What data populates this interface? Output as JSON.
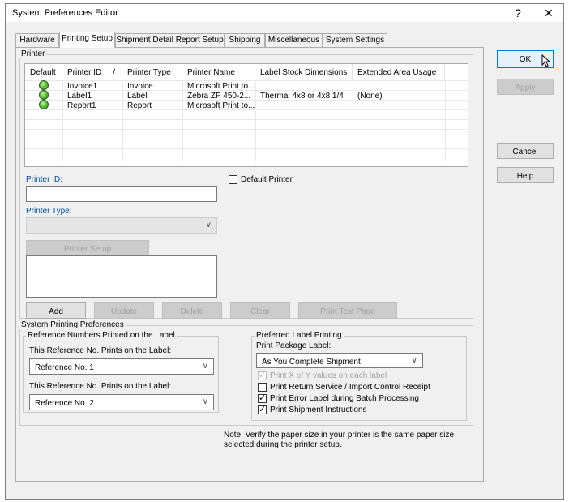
{
  "window": {
    "title": "System Preferences Editor",
    "help_glyph": "?",
    "close_glyph": "✕"
  },
  "tabs": [
    {
      "label": "Hardware"
    },
    {
      "label": "Printing Setup"
    },
    {
      "label": "Shipment Detail Report Setup"
    },
    {
      "label": "Shipping"
    },
    {
      "label": "Miscellaneous"
    },
    {
      "label": "System Settings"
    }
  ],
  "printer_group": {
    "legend": "Printer",
    "grid": {
      "columns": [
        "Default",
        "Printer ID",
        "/",
        "Printer Type",
        "Printer Name",
        "Label Stock Dimensions",
        "Extended Area Usage"
      ],
      "rows": [
        {
          "id": "Invoice1",
          "type": "Invoice",
          "name": "Microsoft Print to...",
          "stock": "",
          "ext": ""
        },
        {
          "id": "Label1",
          "type": "Label",
          "name": "Zebra  ZP 450-2...",
          "stock": "Thermal 4x8 or 4x8 1/4",
          "ext": "(None)"
        },
        {
          "id": "Report1",
          "type": "Report",
          "name": "Microsoft Print to...",
          "stock": "",
          "ext": ""
        }
      ]
    },
    "printer_id_label": "Printer ID:",
    "printer_id_value": "",
    "default_printer_label": "Default Printer",
    "printer_type_label": "Printer Type:",
    "printer_type_value": "",
    "printer_setup_button": "Printer Setup",
    "buttons": {
      "add": "Add",
      "update": "Update",
      "delete": "Delete",
      "clear": "Clear",
      "print_test_page": "Print Test Page"
    }
  },
  "system_printing": {
    "legend": "System Printing Preferences",
    "reference_group": {
      "legend": "Reference Numbers Printed on the Label",
      "label1": "This Reference No. Prints on the Label:",
      "value1": "Reference No. 1",
      "label2": "This Reference No. Prints on the Label:",
      "value2": "Reference No. 2"
    },
    "preferred_group": {
      "legend": "Preferred Label Printing",
      "print_package_label": "Print Package Label:",
      "print_package_value": "As You Complete Shipment",
      "options": [
        {
          "label": "Print X of Y values on each label",
          "checked": true,
          "disabled": true
        },
        {
          "label": "Print Return Service / Import Control Receipt",
          "checked": false,
          "disabled": false
        },
        {
          "label": "Print Error Label during Batch Processing",
          "checked": true,
          "disabled": false
        },
        {
          "label": "Print Shipment Instructions",
          "checked": true,
          "disabled": false
        }
      ]
    },
    "note": "Note: Verify the paper size in your printer is the same paper size selected during the printer setup."
  },
  "side_buttons": {
    "ok": "OK",
    "apply": "Apply",
    "cancel": "Cancel",
    "help": "Help"
  },
  "colors": {
    "dialog_bg": "#f0f0f0",
    "accent_blue": "#0050a0",
    "ok_border": "#0078d7",
    "status_green": "#5fc43a"
  }
}
